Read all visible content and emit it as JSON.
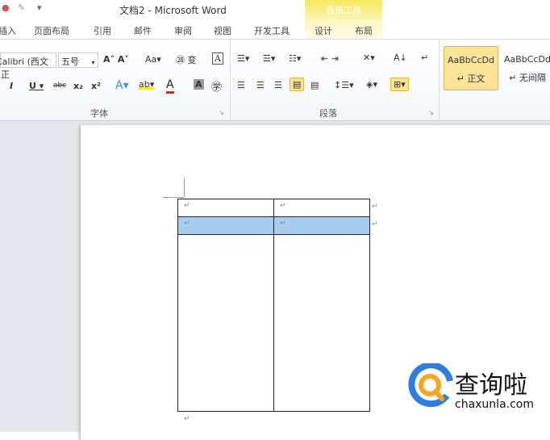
{
  "window": {
    "title": "文档2 - Microsoft Word",
    "context_tab_group": "表格工具"
  },
  "tabs": [
    "插入",
    "页面布局",
    "引用",
    "邮件",
    "审阅",
    "视图",
    "开发工具",
    "设计",
    "布局"
  ],
  "font": {
    "name": "Calibri (西文正",
    "size": "五号"
  },
  "groups": {
    "font": "字体",
    "paragraph": "段落"
  },
  "styles": [
    {
      "preview": "AaBbCcDd",
      "name": "正文"
    },
    {
      "preview": "AaBbCcDd",
      "name": "无间隔"
    }
  ],
  "document": {
    "paragraph_mark": "↵"
  },
  "watermark": {
    "name": "查询啦",
    "url": "chaxunla.com"
  }
}
